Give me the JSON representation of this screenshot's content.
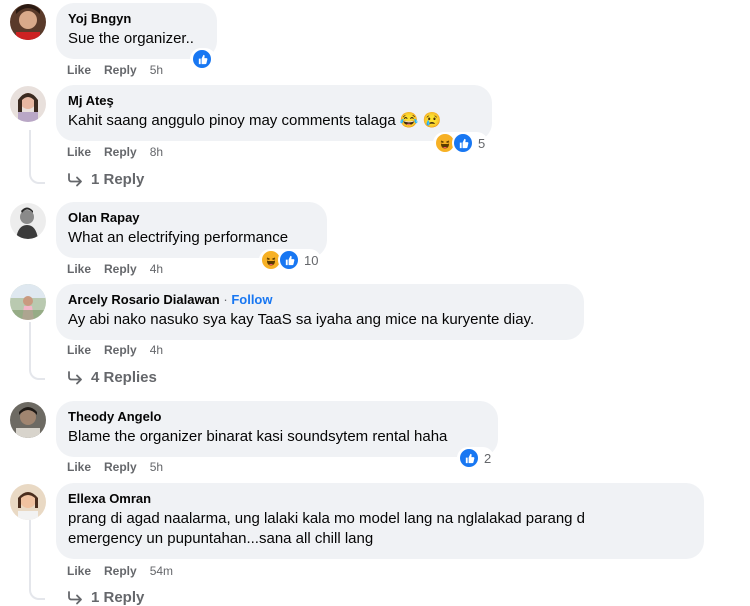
{
  "comments": [
    {
      "author": "Yoj Bngyn",
      "text": "Sue the organizer..",
      "like": "Like",
      "reply": "Reply",
      "time": "5h",
      "reaction_count": ""
    },
    {
      "author": "Mj Ateş",
      "text": "Kahit saang anggulo pinoy may comments talaga 😂 😢",
      "like": "Like",
      "reply": "Reply",
      "time": "8h",
      "reaction_count": "5",
      "replies": "1 Reply"
    },
    {
      "author": "Olan Rapay",
      "text": "What an electrifying performance",
      "like": "Like",
      "reply": "Reply",
      "time": "4h",
      "reaction_count": "10"
    },
    {
      "author": "Arcely Rosario Dialawan",
      "follow_sep": "·",
      "follow": "Follow",
      "text": "Ay abi nako nasuko sya kay TaaS sa iyaha ang mice na kuryente diay.",
      "like": "Like",
      "reply": "Reply",
      "time": "4h",
      "replies": "4 Replies"
    },
    {
      "author": "Theody Angelo",
      "text": "Blame the organizer binarat kasi soundsytem rental haha",
      "like": "Like",
      "reply": "Reply",
      "time": "5h",
      "reaction_count": "2"
    },
    {
      "author": "Ellexa Omran",
      "text_line1": "prang di agad naalarma, ung lalaki kala mo model lang na nglalakad parang d",
      "text_line2": "emergency un pupuntahan...sana all chill lang",
      "like": "Like",
      "reply": "Reply",
      "time": "54m",
      "replies": "1 Reply"
    }
  ],
  "colors": {
    "bubble": "#f0f2f5",
    "meta": "#65676b",
    "link": "#1877f2",
    "like_reaction": "#1877f2",
    "haha_reaction": "#f7b125"
  }
}
